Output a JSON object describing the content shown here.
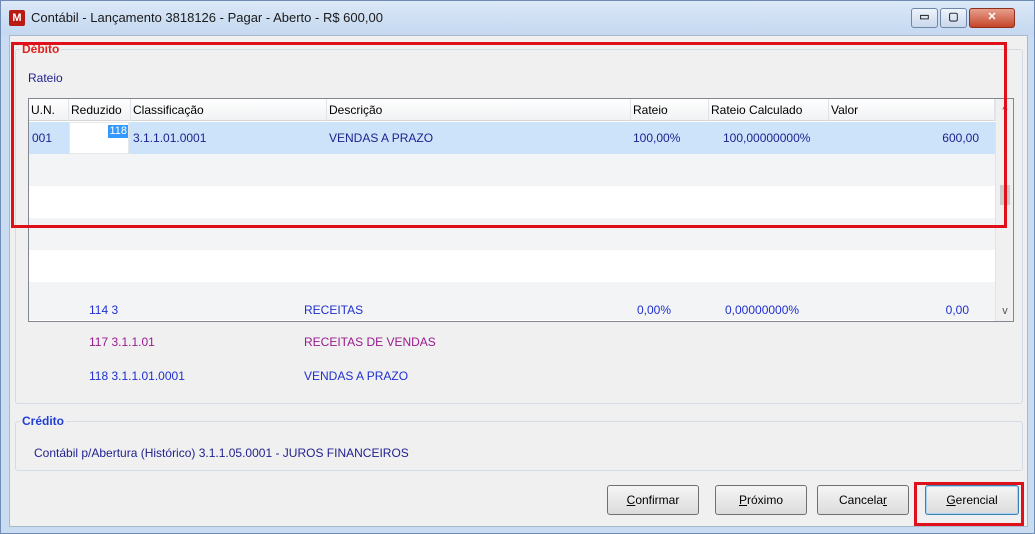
{
  "window": {
    "title": "Contábil - Lançamento 3818126 - Pagar - Aberto - R$ 600,00",
    "icon_label": "M",
    "controls": {
      "minimize": "▭",
      "maximize": "▢",
      "close": "✕"
    }
  },
  "debit": {
    "legend": "Débito",
    "rateio_label": "Rateio",
    "grid": {
      "headers": [
        "U.N.",
        "Reduzido",
        "Classificação",
        "Descrição",
        "Rateio",
        "Rateio Calculado",
        "Valor"
      ],
      "rows": [
        {
          "un": "001",
          "reduzido": "118",
          "classificacao": "3.1.1.01.0001",
          "descricao": "VENDAS A PRAZO",
          "rateio": "100,00%",
          "rateio_calculado": "100,00000000%",
          "valor": "600,00"
        }
      ],
      "scroll_up": "^",
      "scroll_down": "v"
    },
    "tree": [
      {
        "code": "114 3",
        "descricao": "RECEITAS",
        "rateio": "0,00%",
        "rateio_calculado": "0,00000000%",
        "valor": "0,00"
      },
      {
        "code": "117 3.1.1.01",
        "descricao": "RECEITAS DE VENDAS"
      },
      {
        "code": "118 3.1.1.01.0001",
        "descricao": "VENDAS A PRAZO"
      }
    ]
  },
  "credit": {
    "legend": "Crédito",
    "text": "Contábil p/Abertura (Histórico) 3.1.1.05.0001 - JUROS FINANCEIROS"
  },
  "buttons": {
    "confirmar": {
      "mnemonic": "C",
      "rest": "onfirmar"
    },
    "proximo": {
      "mnemonic": "P",
      "rest": "róximo"
    },
    "cancelar": {
      "before": "Cancela",
      "mnemonic": "r"
    },
    "gerencial": {
      "mnemonic": "G",
      "rest": "erencial"
    }
  },
  "colors": {
    "highlight": "#e0101b",
    "selected_row": "#cce3f9",
    "debit_legend": "#e0221c",
    "credit_legend": "#1f3fd6"
  }
}
